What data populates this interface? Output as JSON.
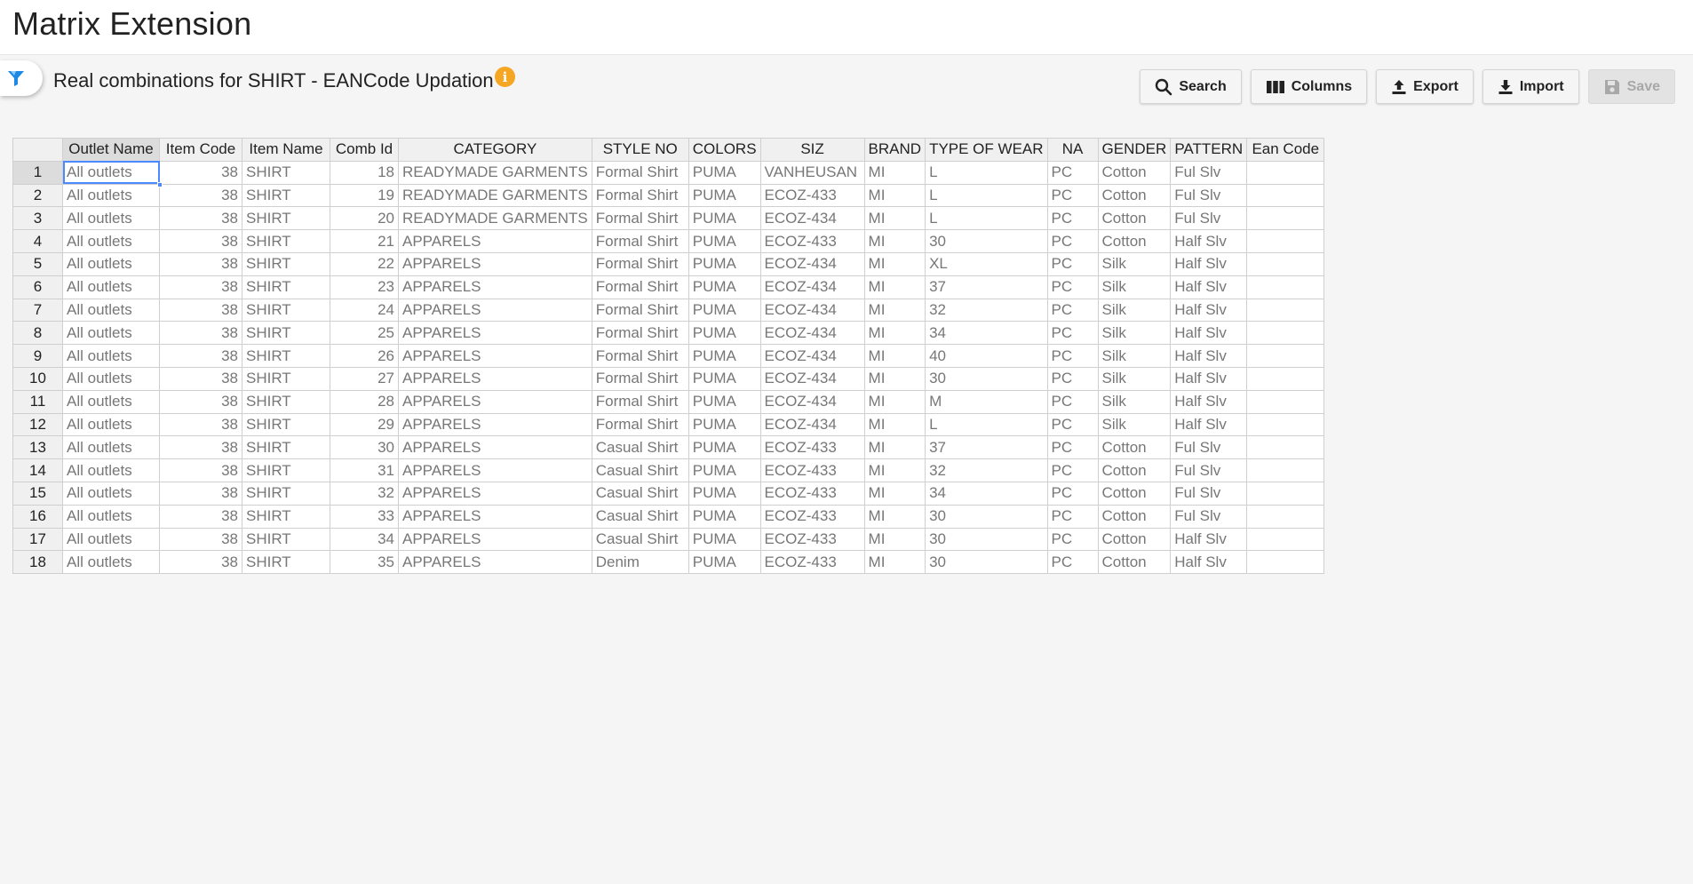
{
  "header": {
    "title": "Matrix Extension"
  },
  "subheader": {
    "title": "Real combinations for SHIRT - EANCode Updation",
    "info_icon": "info-icon"
  },
  "toolbar": {
    "search_label": "Search",
    "columns_label": "Columns",
    "export_label": "Export",
    "import_label": "Import",
    "save_label": "Save"
  },
  "colors": {
    "accent": "#4b89ff",
    "info": "#f5a623",
    "filter": "#1e88e5"
  },
  "table": {
    "columns": [
      "Outlet Name",
      "Item Code",
      "Item Name",
      "Comb Id",
      "CATEGORY",
      "STYLE NO",
      "COLORS",
      "SIZ",
      "BRAND",
      "TYPE OF WEAR",
      "NA",
      "GENDER",
      "PATTERN",
      "Ean Code"
    ],
    "rows": [
      {
        "n": "1",
        "outlet": "All outlets",
        "item_code": "38",
        "item_name": "SHIRT",
        "comb_id": "18",
        "category": "READYMADE GARMENTS",
        "style": "Formal Shirt",
        "colors": "PUMA",
        "siz": "VANHEUSAN",
        "brand": "MI",
        "wear": "L",
        "na": "PC",
        "gender": "Cotton",
        "pattern": "Ful Slv",
        "ean": ""
      },
      {
        "n": "2",
        "outlet": "All outlets",
        "item_code": "38",
        "item_name": "SHIRT",
        "comb_id": "19",
        "category": "READYMADE GARMENTS",
        "style": "Formal Shirt",
        "colors": "PUMA",
        "siz": "ECOZ-433",
        "brand": "MI",
        "wear": "L",
        "na": "PC",
        "gender": "Cotton",
        "pattern": "Ful Slv",
        "ean": ""
      },
      {
        "n": "3",
        "outlet": "All outlets",
        "item_code": "38",
        "item_name": "SHIRT",
        "comb_id": "20",
        "category": "READYMADE GARMENTS",
        "style": "Formal Shirt",
        "colors": "PUMA",
        "siz": "ECOZ-434",
        "brand": "MI",
        "wear": "L",
        "na": "PC",
        "gender": "Cotton",
        "pattern": "Ful Slv",
        "ean": ""
      },
      {
        "n": "4",
        "outlet": "All outlets",
        "item_code": "38",
        "item_name": "SHIRT",
        "comb_id": "21",
        "category": "APPARELS",
        "style": "Formal Shirt",
        "colors": "PUMA",
        "siz": "ECOZ-433",
        "brand": "MI",
        "wear": "30",
        "na": "PC",
        "gender": "Cotton",
        "pattern": "Half Slv",
        "ean": ""
      },
      {
        "n": "5",
        "outlet": "All outlets",
        "item_code": "38",
        "item_name": "SHIRT",
        "comb_id": "22",
        "category": "APPARELS",
        "style": "Formal Shirt",
        "colors": "PUMA",
        "siz": "ECOZ-434",
        "brand": "MI",
        "wear": "XL",
        "na": "PC",
        "gender": "Silk",
        "pattern": "Half Slv",
        "ean": ""
      },
      {
        "n": "6",
        "outlet": "All outlets",
        "item_code": "38",
        "item_name": "SHIRT",
        "comb_id": "23",
        "category": "APPARELS",
        "style": "Formal Shirt",
        "colors": "PUMA",
        "siz": "ECOZ-434",
        "brand": "MI",
        "wear": "37",
        "na": "PC",
        "gender": "Silk",
        "pattern": "Half Slv",
        "ean": ""
      },
      {
        "n": "7",
        "outlet": "All outlets",
        "item_code": "38",
        "item_name": "SHIRT",
        "comb_id": "24",
        "category": "APPARELS",
        "style": "Formal Shirt",
        "colors": "PUMA",
        "siz": "ECOZ-434",
        "brand": "MI",
        "wear": "32",
        "na": "PC",
        "gender": "Silk",
        "pattern": "Half Slv",
        "ean": ""
      },
      {
        "n": "8",
        "outlet": "All outlets",
        "item_code": "38",
        "item_name": "SHIRT",
        "comb_id": "25",
        "category": "APPARELS",
        "style": "Formal Shirt",
        "colors": "PUMA",
        "siz": "ECOZ-434",
        "brand": "MI",
        "wear": "34",
        "na": "PC",
        "gender": "Silk",
        "pattern": "Half Slv",
        "ean": ""
      },
      {
        "n": "9",
        "outlet": "All outlets",
        "item_code": "38",
        "item_name": "SHIRT",
        "comb_id": "26",
        "category": "APPARELS",
        "style": "Formal Shirt",
        "colors": "PUMA",
        "siz": "ECOZ-434",
        "brand": "MI",
        "wear": "40",
        "na": "PC",
        "gender": "Silk",
        "pattern": "Half Slv",
        "ean": ""
      },
      {
        "n": "10",
        "outlet": "All outlets",
        "item_code": "38",
        "item_name": "SHIRT",
        "comb_id": "27",
        "category": "APPARELS",
        "style": "Formal Shirt",
        "colors": "PUMA",
        "siz": "ECOZ-434",
        "brand": "MI",
        "wear": "30",
        "na": "PC",
        "gender": "Silk",
        "pattern": "Half Slv",
        "ean": ""
      },
      {
        "n": "11",
        "outlet": "All outlets",
        "item_code": "38",
        "item_name": "SHIRT",
        "comb_id": "28",
        "category": "APPARELS",
        "style": "Formal Shirt",
        "colors": "PUMA",
        "siz": "ECOZ-434",
        "brand": "MI",
        "wear": "M",
        "na": "PC",
        "gender": "Silk",
        "pattern": "Half Slv",
        "ean": ""
      },
      {
        "n": "12",
        "outlet": "All outlets",
        "item_code": "38",
        "item_name": "SHIRT",
        "comb_id": "29",
        "category": "APPARELS",
        "style": "Formal Shirt",
        "colors": "PUMA",
        "siz": "ECOZ-434",
        "brand": "MI",
        "wear": "L",
        "na": "PC",
        "gender": "Silk",
        "pattern": "Half Slv",
        "ean": ""
      },
      {
        "n": "13",
        "outlet": "All outlets",
        "item_code": "38",
        "item_name": "SHIRT",
        "comb_id": "30",
        "category": "APPARELS",
        "style": "Casual Shirt",
        "colors": "PUMA",
        "siz": "ECOZ-433",
        "brand": "MI",
        "wear": "37",
        "na": "PC",
        "gender": "Cotton",
        "pattern": "Ful Slv",
        "ean": ""
      },
      {
        "n": "14",
        "outlet": "All outlets",
        "item_code": "38",
        "item_name": "SHIRT",
        "comb_id": "31",
        "category": "APPARELS",
        "style": "Casual Shirt",
        "colors": "PUMA",
        "siz": "ECOZ-433",
        "brand": "MI",
        "wear": "32",
        "na": "PC",
        "gender": "Cotton",
        "pattern": "Ful Slv",
        "ean": ""
      },
      {
        "n": "15",
        "outlet": "All outlets",
        "item_code": "38",
        "item_name": "SHIRT",
        "comb_id": "32",
        "category": "APPARELS",
        "style": "Casual Shirt",
        "colors": "PUMA",
        "siz": "ECOZ-433",
        "brand": "MI",
        "wear": "34",
        "na": "PC",
        "gender": "Cotton",
        "pattern": "Ful Slv",
        "ean": ""
      },
      {
        "n": "16",
        "outlet": "All outlets",
        "item_code": "38",
        "item_name": "SHIRT",
        "comb_id": "33",
        "category": "APPARELS",
        "style": "Casual Shirt",
        "colors": "PUMA",
        "siz": "ECOZ-433",
        "brand": "MI",
        "wear": "30",
        "na": "PC",
        "gender": "Cotton",
        "pattern": "Ful Slv",
        "ean": ""
      },
      {
        "n": "17",
        "outlet": "All outlets",
        "item_code": "38",
        "item_name": "SHIRT",
        "comb_id": "34",
        "category": "APPARELS",
        "style": "Casual Shirt",
        "colors": "PUMA",
        "siz": "ECOZ-433",
        "brand": "MI",
        "wear": "30",
        "na": "PC",
        "gender": "Cotton",
        "pattern": "Half Slv",
        "ean": ""
      },
      {
        "n": "18",
        "outlet": "All outlets",
        "item_code": "38",
        "item_name": "SHIRT",
        "comb_id": "35",
        "category": "APPARELS",
        "style": "Denim",
        "colors": "PUMA",
        "siz": "ECOZ-433",
        "brand": "MI",
        "wear": "30",
        "na": "PC",
        "gender": "Cotton",
        "pattern": "Half Slv",
        "ean": ""
      }
    ]
  }
}
